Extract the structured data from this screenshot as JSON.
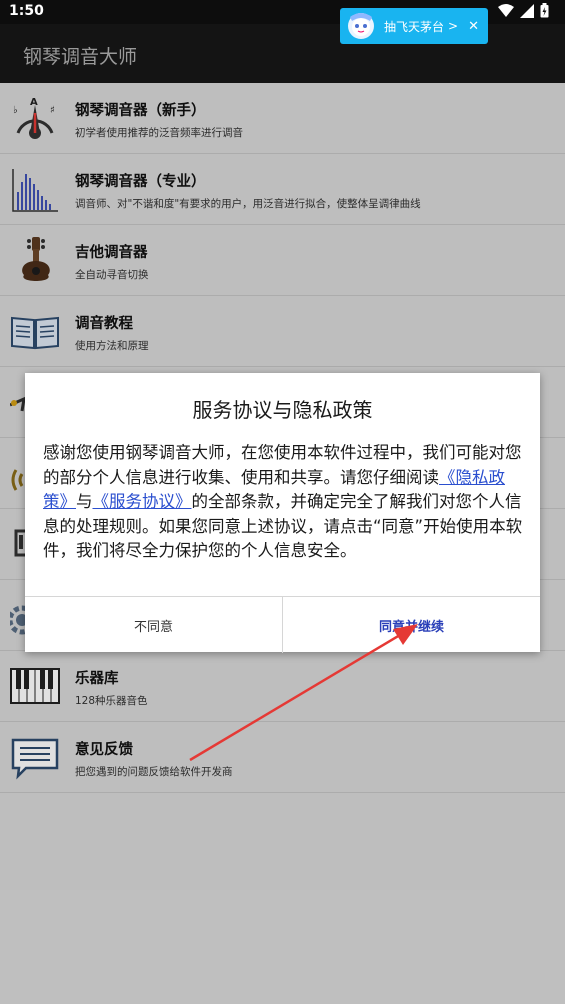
{
  "status_bar": {
    "time": "1:50"
  },
  "app_bar": {
    "title": "钢琴调音大师"
  },
  "ad_banner": {
    "text": "抽飞天茅台",
    "chevron": ">",
    "close": "✕"
  },
  "list": {
    "items": [
      {
        "title": "钢琴调音器（新手）",
        "subtitle": "初学者使用推荐的泛音频率进行调音",
        "icon": "tuner-dial-icon"
      },
      {
        "title": "钢琴调音器（专业）",
        "subtitle": "调音师、对\"不谐和度\"有要求的用户，用泛音进行拟合，使整体呈调律曲线",
        "icon": "spectrum-bars-icon"
      },
      {
        "title": "吉他调音器",
        "subtitle": "全自动寻音切换",
        "icon": "guitar-icon"
      },
      {
        "title": "调音教程",
        "subtitle": "使用方法和原理",
        "icon": "book-icon"
      },
      {
        "title": "",
        "subtitle": "",
        "icon": "metronome-icon"
      },
      {
        "title": "",
        "subtitle": "",
        "icon": "sound-wave-icon"
      },
      {
        "title": "",
        "subtitle": "",
        "icon": "piano-display-icon"
      },
      {
        "title": "",
        "subtitle": "",
        "icon": "settings-gear-icon"
      },
      {
        "title": "乐器库",
        "subtitle": "128种乐器音色",
        "icon": "piano-keys-icon"
      },
      {
        "title": "意见反馈",
        "subtitle": "把您遇到的问题反馈给软件开发商",
        "icon": "chat-bubble-icon"
      }
    ]
  },
  "dialog": {
    "title": "服务协议与隐私政策",
    "body_part1": "感谢您使用钢琴调音大师，在您使用本软件过程中，我们可能对您的部分个人信息进行收集、使用和共享。请您仔细阅读",
    "privacy_link": "《隐私政策》",
    "connector": "与",
    "service_link": "《服务协议》",
    "body_part2": "的全部条款，并确定完全了解我们对您个人信息的处理规则。如果您同意上述协议，请点击“同意”开始使用本软件，我们将尽全力保护您的个人信息安全。",
    "decline_label": "不同意",
    "accept_label": "同意并继续"
  },
  "colors": {
    "accent": "#2a3fb8",
    "link": "#2b4fcf",
    "arrow": "#e53935",
    "ad_bg": "#19b4f0"
  }
}
